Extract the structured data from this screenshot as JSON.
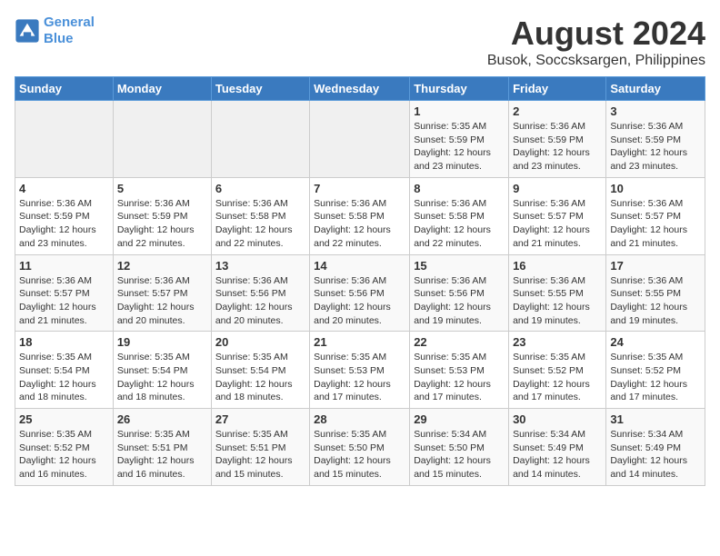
{
  "logo": {
    "line1": "General",
    "line2": "Blue"
  },
  "title": "August 2024",
  "subtitle": "Busok, Soccsksargen, Philippines",
  "days_of_week": [
    "Sunday",
    "Monday",
    "Tuesday",
    "Wednesday",
    "Thursday",
    "Friday",
    "Saturday"
  ],
  "weeks": [
    [
      {
        "day": "",
        "info": ""
      },
      {
        "day": "",
        "info": ""
      },
      {
        "day": "",
        "info": ""
      },
      {
        "day": "",
        "info": ""
      },
      {
        "day": "1",
        "info": "Sunrise: 5:35 AM\nSunset: 5:59 PM\nDaylight: 12 hours\nand 23 minutes."
      },
      {
        "day": "2",
        "info": "Sunrise: 5:36 AM\nSunset: 5:59 PM\nDaylight: 12 hours\nand 23 minutes."
      },
      {
        "day": "3",
        "info": "Sunrise: 5:36 AM\nSunset: 5:59 PM\nDaylight: 12 hours\nand 23 minutes."
      }
    ],
    [
      {
        "day": "4",
        "info": "Sunrise: 5:36 AM\nSunset: 5:59 PM\nDaylight: 12 hours\nand 23 minutes."
      },
      {
        "day": "5",
        "info": "Sunrise: 5:36 AM\nSunset: 5:59 PM\nDaylight: 12 hours\nand 22 minutes."
      },
      {
        "day": "6",
        "info": "Sunrise: 5:36 AM\nSunset: 5:58 PM\nDaylight: 12 hours\nand 22 minutes."
      },
      {
        "day": "7",
        "info": "Sunrise: 5:36 AM\nSunset: 5:58 PM\nDaylight: 12 hours\nand 22 minutes."
      },
      {
        "day": "8",
        "info": "Sunrise: 5:36 AM\nSunset: 5:58 PM\nDaylight: 12 hours\nand 22 minutes."
      },
      {
        "day": "9",
        "info": "Sunrise: 5:36 AM\nSunset: 5:57 PM\nDaylight: 12 hours\nand 21 minutes."
      },
      {
        "day": "10",
        "info": "Sunrise: 5:36 AM\nSunset: 5:57 PM\nDaylight: 12 hours\nand 21 minutes."
      }
    ],
    [
      {
        "day": "11",
        "info": "Sunrise: 5:36 AM\nSunset: 5:57 PM\nDaylight: 12 hours\nand 21 minutes."
      },
      {
        "day": "12",
        "info": "Sunrise: 5:36 AM\nSunset: 5:57 PM\nDaylight: 12 hours\nand 20 minutes."
      },
      {
        "day": "13",
        "info": "Sunrise: 5:36 AM\nSunset: 5:56 PM\nDaylight: 12 hours\nand 20 minutes."
      },
      {
        "day": "14",
        "info": "Sunrise: 5:36 AM\nSunset: 5:56 PM\nDaylight: 12 hours\nand 20 minutes."
      },
      {
        "day": "15",
        "info": "Sunrise: 5:36 AM\nSunset: 5:56 PM\nDaylight: 12 hours\nand 19 minutes."
      },
      {
        "day": "16",
        "info": "Sunrise: 5:36 AM\nSunset: 5:55 PM\nDaylight: 12 hours\nand 19 minutes."
      },
      {
        "day": "17",
        "info": "Sunrise: 5:36 AM\nSunset: 5:55 PM\nDaylight: 12 hours\nand 19 minutes."
      }
    ],
    [
      {
        "day": "18",
        "info": "Sunrise: 5:35 AM\nSunset: 5:54 PM\nDaylight: 12 hours\nand 18 minutes."
      },
      {
        "day": "19",
        "info": "Sunrise: 5:35 AM\nSunset: 5:54 PM\nDaylight: 12 hours\nand 18 minutes."
      },
      {
        "day": "20",
        "info": "Sunrise: 5:35 AM\nSunset: 5:54 PM\nDaylight: 12 hours\nand 18 minutes."
      },
      {
        "day": "21",
        "info": "Sunrise: 5:35 AM\nSunset: 5:53 PM\nDaylight: 12 hours\nand 17 minutes."
      },
      {
        "day": "22",
        "info": "Sunrise: 5:35 AM\nSunset: 5:53 PM\nDaylight: 12 hours\nand 17 minutes."
      },
      {
        "day": "23",
        "info": "Sunrise: 5:35 AM\nSunset: 5:52 PM\nDaylight: 12 hours\nand 17 minutes."
      },
      {
        "day": "24",
        "info": "Sunrise: 5:35 AM\nSunset: 5:52 PM\nDaylight: 12 hours\nand 17 minutes."
      }
    ],
    [
      {
        "day": "25",
        "info": "Sunrise: 5:35 AM\nSunset: 5:52 PM\nDaylight: 12 hours\nand 16 minutes."
      },
      {
        "day": "26",
        "info": "Sunrise: 5:35 AM\nSunset: 5:51 PM\nDaylight: 12 hours\nand 16 minutes."
      },
      {
        "day": "27",
        "info": "Sunrise: 5:35 AM\nSunset: 5:51 PM\nDaylight: 12 hours\nand 15 minutes."
      },
      {
        "day": "28",
        "info": "Sunrise: 5:35 AM\nSunset: 5:50 PM\nDaylight: 12 hours\nand 15 minutes."
      },
      {
        "day": "29",
        "info": "Sunrise: 5:34 AM\nSunset: 5:50 PM\nDaylight: 12 hours\nand 15 minutes."
      },
      {
        "day": "30",
        "info": "Sunrise: 5:34 AM\nSunset: 5:49 PM\nDaylight: 12 hours\nand 14 minutes."
      },
      {
        "day": "31",
        "info": "Sunrise: 5:34 AM\nSunset: 5:49 PM\nDaylight: 12 hours\nand 14 minutes."
      }
    ]
  ]
}
